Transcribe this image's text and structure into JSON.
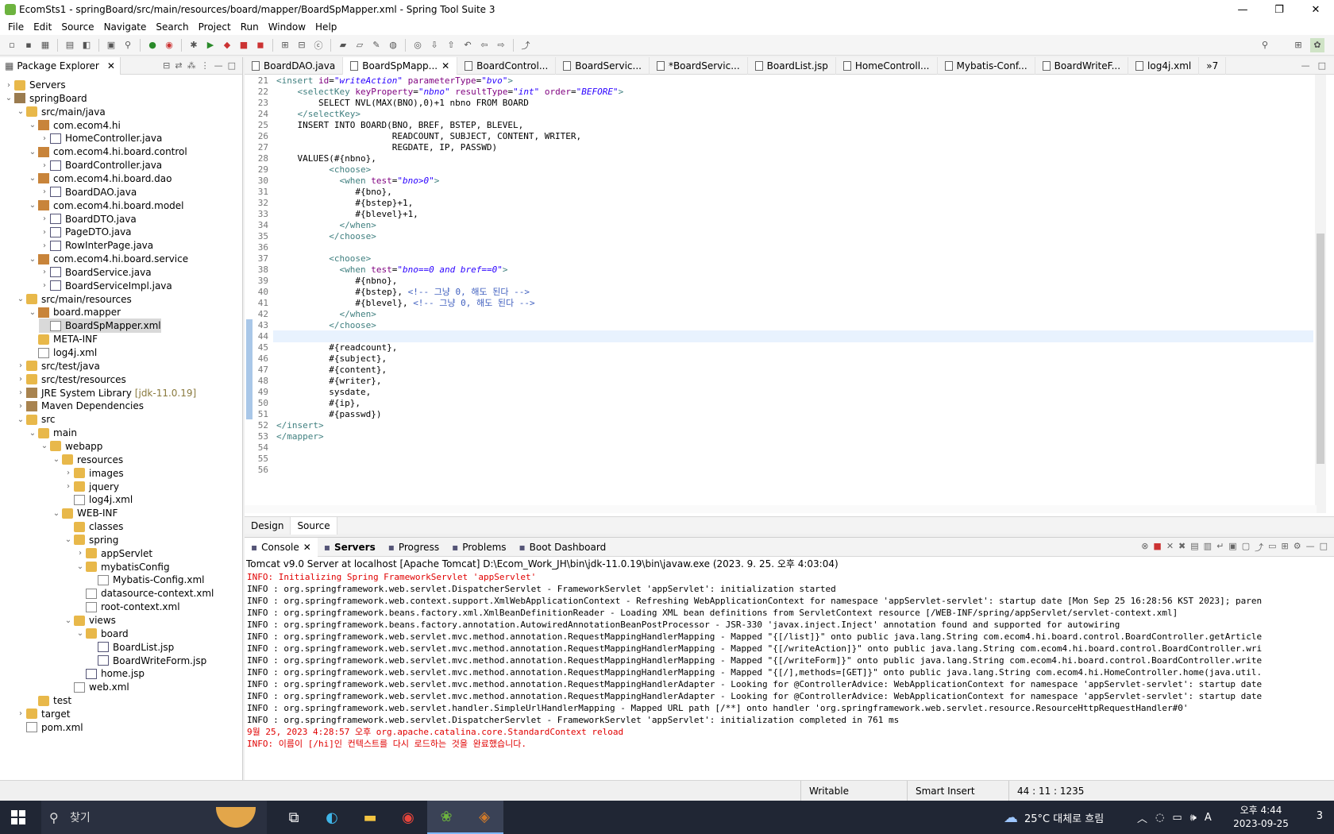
{
  "window": {
    "title": "EcomSts1 - springBoard/src/main/resources/board/mapper/BoardSpMapper.xml - Spring Tool Suite 3"
  },
  "menu": [
    "File",
    "Edit",
    "Source",
    "Navigate",
    "Search",
    "Project",
    "Run",
    "Window",
    "Help"
  ],
  "package_explorer": {
    "title": "Package Explorer",
    "tree": [
      {
        "label": "Servers",
        "depth": 0,
        "icon": "folder",
        "arrow": "›"
      },
      {
        "label": "springBoard",
        "depth": 0,
        "icon": "proj",
        "arrow": "⌄"
      },
      {
        "label": "src/main/java",
        "depth": 1,
        "icon": "folder",
        "arrow": "⌄"
      },
      {
        "label": "com.ecom4.hi",
        "depth": 2,
        "icon": "pkg",
        "arrow": "⌄"
      },
      {
        "label": "HomeController.java",
        "depth": 3,
        "icon": "java",
        "arrow": "›"
      },
      {
        "label": "com.ecom4.hi.board.control",
        "depth": 2,
        "icon": "pkg",
        "arrow": "⌄"
      },
      {
        "label": "BoardController.java",
        "depth": 3,
        "icon": "java",
        "arrow": "›"
      },
      {
        "label": "com.ecom4.hi.board.dao",
        "depth": 2,
        "icon": "pkg",
        "arrow": "⌄"
      },
      {
        "label": "BoardDAO.java",
        "depth": 3,
        "icon": "java",
        "arrow": "›"
      },
      {
        "label": "com.ecom4.hi.board.model",
        "depth": 2,
        "icon": "pkg",
        "arrow": "⌄"
      },
      {
        "label": "BoardDTO.java",
        "depth": 3,
        "icon": "java",
        "arrow": "›"
      },
      {
        "label": "PageDTO.java",
        "depth": 3,
        "icon": "java",
        "arrow": "›"
      },
      {
        "label": "RowInterPage.java",
        "depth": 3,
        "icon": "java",
        "arrow": "›"
      },
      {
        "label": "com.ecom4.hi.board.service",
        "depth": 2,
        "icon": "pkg",
        "arrow": "⌄"
      },
      {
        "label": "BoardService.java",
        "depth": 3,
        "icon": "java",
        "arrow": "›"
      },
      {
        "label": "BoardServiceImpl.java",
        "depth": 3,
        "icon": "java",
        "arrow": "›"
      },
      {
        "label": "src/main/resources",
        "depth": 1,
        "icon": "folder",
        "arrow": "⌄"
      },
      {
        "label": "board.mapper",
        "depth": 2,
        "icon": "pkg",
        "arrow": "⌄"
      },
      {
        "label": "BoardSpMapper.xml",
        "depth": 3,
        "icon": "xml",
        "arrow": "",
        "selected": true
      },
      {
        "label": "META-INF",
        "depth": 2,
        "icon": "folder",
        "arrow": ""
      },
      {
        "label": "log4j.xml",
        "depth": 2,
        "icon": "xml",
        "arrow": ""
      },
      {
        "label": "src/test/java",
        "depth": 1,
        "icon": "folder",
        "arrow": "›"
      },
      {
        "label": "src/test/resources",
        "depth": 1,
        "icon": "folder",
        "arrow": "›"
      },
      {
        "label": "JRE System Library",
        "extra": "[jdk-11.0.19]",
        "depth": 1,
        "icon": "lib",
        "arrow": "›"
      },
      {
        "label": "Maven Dependencies",
        "depth": 1,
        "icon": "lib",
        "arrow": "›"
      },
      {
        "label": "src",
        "depth": 1,
        "icon": "folder",
        "arrow": "⌄"
      },
      {
        "label": "main",
        "depth": 2,
        "icon": "folder",
        "arrow": "⌄"
      },
      {
        "label": "webapp",
        "depth": 3,
        "icon": "folder",
        "arrow": "⌄"
      },
      {
        "label": "resources",
        "depth": 4,
        "icon": "folder",
        "arrow": "⌄"
      },
      {
        "label": "images",
        "depth": 5,
        "icon": "folder",
        "arrow": "›"
      },
      {
        "label": "jquery",
        "depth": 5,
        "icon": "folder",
        "arrow": "›"
      },
      {
        "label": "log4j.xml",
        "depth": 5,
        "icon": "xml",
        "arrow": ""
      },
      {
        "label": "WEB-INF",
        "depth": 4,
        "icon": "folder",
        "arrow": "⌄"
      },
      {
        "label": "classes",
        "depth": 5,
        "icon": "folder",
        "arrow": ""
      },
      {
        "label": "spring",
        "depth": 5,
        "icon": "folder",
        "arrow": "⌄"
      },
      {
        "label": "appServlet",
        "depth": 6,
        "icon": "folder",
        "arrow": "›"
      },
      {
        "label": "mybatisConfig",
        "depth": 6,
        "icon": "folder",
        "arrow": "⌄"
      },
      {
        "label": "Mybatis-Config.xml",
        "depth": 7,
        "icon": "xml",
        "arrow": ""
      },
      {
        "label": "datasource-context.xml",
        "depth": 6,
        "icon": "xml",
        "arrow": ""
      },
      {
        "label": "root-context.xml",
        "depth": 6,
        "icon": "xml",
        "arrow": ""
      },
      {
        "label": "views",
        "depth": 5,
        "icon": "folder",
        "arrow": "⌄"
      },
      {
        "label": "board",
        "depth": 6,
        "icon": "folder",
        "arrow": "⌄"
      },
      {
        "label": "BoardList.jsp",
        "depth": 7,
        "icon": "java",
        "arrow": ""
      },
      {
        "label": "BoardWriteForm.jsp",
        "depth": 7,
        "icon": "java",
        "arrow": ""
      },
      {
        "label": "home.jsp",
        "depth": 6,
        "icon": "java",
        "arrow": ""
      },
      {
        "label": "web.xml",
        "depth": 5,
        "icon": "xml",
        "arrow": ""
      },
      {
        "label": "test",
        "depth": 2,
        "icon": "folder",
        "arrow": ""
      },
      {
        "label": "target",
        "depth": 1,
        "icon": "folder",
        "arrow": "›"
      },
      {
        "label": "pom.xml",
        "depth": 1,
        "icon": "xml",
        "arrow": ""
      }
    ]
  },
  "editor": {
    "tabs": [
      {
        "label": "BoardDAO.java",
        "active": false
      },
      {
        "label": "BoardSpMapp...",
        "active": true,
        "closable": true
      },
      {
        "label": "BoardControl...",
        "active": false
      },
      {
        "label": "BoardServic...",
        "active": false
      },
      {
        "label": "*BoardServic...",
        "active": false
      },
      {
        "label": "BoardList.jsp",
        "active": false
      },
      {
        "label": "HomeControll...",
        "active": false
      },
      {
        "label": "Mybatis-Conf...",
        "active": false
      },
      {
        "label": "BoardWriteF...",
        "active": false
      },
      {
        "label": "log4j.xml",
        "active": false
      },
      {
        "label": "»7",
        "active": false
      }
    ],
    "lines": [
      {
        "n": "21",
        "html": "<span class=\"tag\">&lt;insert</span> <span class=\"att\">id</span>=<span class=\"val\">\"writeAction\"</span> <span class=\"att\">parameterType</span>=<span class=\"val\">\"bvo\"</span><span class=\"tag\">&gt;</span>"
      },
      {
        "n": "22",
        "html": "    <span class=\"tag\">&lt;selectKey</span> <span class=\"att\">keyProperty</span>=<span class=\"val\">\"nbno\"</span> <span class=\"att\">resultType</span>=<span class=\"val\">\"int\"</span> <span class=\"att\">order</span>=<span class=\"val\">\"BEFORE\"</span><span class=\"tag\">&gt;</span>"
      },
      {
        "n": "23",
        "html": "        SELECT NVL(MAX(BNO),0)+1 nbno FROM BOARD"
      },
      {
        "n": "24",
        "html": "    <span class=\"tag\">&lt;/selectKey&gt;</span>"
      },
      {
        "n": "25",
        "html": "    INSERT INTO BOARD(BNO, BREF, BSTEP, BLEVEL,"
      },
      {
        "n": "26",
        "html": "                      READCOUNT, SUBJECT, CONTENT, WRITER,"
      },
      {
        "n": "27",
        "html": "                      REGDATE, IP, PASSWD)"
      },
      {
        "n": "28",
        "html": "    VALUES(#{nbno},"
      },
      {
        "n": "29",
        "html": "          <span class=\"tag\">&lt;choose&gt;</span>"
      },
      {
        "n": "30",
        "html": "            <span class=\"tag\">&lt;when</span> <span class=\"att\">test</span>=<span class=\"val\">\"bno&gt;0\"</span><span class=\"tag\">&gt;</span>"
      },
      {
        "n": "31",
        "html": "               #{bno},"
      },
      {
        "n": "32",
        "html": "               #{bstep}+1,"
      },
      {
        "n": "33",
        "html": "               #{blevel}+1,"
      },
      {
        "n": "34",
        "html": "            <span class=\"tag\">&lt;/when&gt;</span>"
      },
      {
        "n": "35",
        "html": "          <span class=\"tag\">&lt;/choose&gt;</span>"
      },
      {
        "n": "36",
        "html": ""
      },
      {
        "n": "37",
        "html": "          <span class=\"tag\">&lt;choose&gt;</span>"
      },
      {
        "n": "38",
        "html": "            <span class=\"tag\">&lt;when</span> <span class=\"att\">test</span>=<span class=\"val\">\"bno==0 and bref==0\"</span><span class=\"tag\">&gt;</span>"
      },
      {
        "n": "39",
        "html": "               #{nbno},"
      },
      {
        "n": "40",
        "html": "               #{bstep}, <span class=\"cmt\">&lt;!-- 그냥 0, 해도 된다 --&gt;</span>"
      },
      {
        "n": "41",
        "html": "               #{blevel}, <span class=\"cmt\">&lt;!-- 그냥 0, 해도 된다 --&gt;</span>"
      },
      {
        "n": "42",
        "html": "            <span class=\"tag\">&lt;/when&gt;</span>"
      },
      {
        "n": "43",
        "html": "          <span class=\"tag\">&lt;/choose&gt;</span>"
      },
      {
        "n": "44",
        "html": ""
      },
      {
        "n": "45",
        "html": "          #{readcount},"
      },
      {
        "n": "46",
        "html": "          #{subject},"
      },
      {
        "n": "47",
        "html": "          #{content},"
      },
      {
        "n": "48",
        "html": "          #{writer},"
      },
      {
        "n": "49",
        "html": "          sysdate,"
      },
      {
        "n": "50",
        "html": "          #{ip},"
      },
      {
        "n": "51",
        "html": "          #{passwd})"
      },
      {
        "n": "52",
        "html": "<span class=\"tag\">&lt;/insert&gt;</span>"
      },
      {
        "n": "53",
        "html": "<span class=\"tag\">&lt;/mapper&gt;</span>"
      },
      {
        "n": "54",
        "html": ""
      },
      {
        "n": "55",
        "html": ""
      },
      {
        "n": "56",
        "html": ""
      }
    ],
    "bottom_tabs": [
      "Design",
      "Source"
    ]
  },
  "console": {
    "tabs": [
      {
        "label": "Console",
        "active": true
      },
      {
        "label": "Servers",
        "active": false
      },
      {
        "label": "Progress",
        "active": false
      },
      {
        "label": "Problems",
        "active": false
      },
      {
        "label": "Boot Dashboard",
        "active": false
      }
    ],
    "header": "Tomcat v9.0 Server at localhost [Apache Tomcat] D:\\Ecom_Work_JH\\bin\\jdk-11.0.19\\bin\\javaw.exe  (2023. 9. 25. 오후 4:03:04)",
    "lines": [
      {
        "text": "INFO: Initializing Spring FrameworkServlet 'appServlet'",
        "red": true
      },
      {
        "text": "INFO : org.springframework.web.servlet.DispatcherServlet - FrameworkServlet 'appServlet': initialization started",
        "red": false
      },
      {
        "text": "INFO : org.springframework.web.context.support.XmlWebApplicationContext - Refreshing WebApplicationContext for namespace 'appServlet-servlet': startup date [Mon Sep 25 16:28:56 KST 2023]; paren",
        "red": false
      },
      {
        "text": "INFO : org.springframework.beans.factory.xml.XmlBeanDefinitionReader - Loading XML bean definitions from ServletContext resource [/WEB-INF/spring/appServlet/servlet-context.xml]",
        "red": false
      },
      {
        "text": "INFO : org.springframework.beans.factory.annotation.AutowiredAnnotationBeanPostProcessor - JSR-330 'javax.inject.Inject' annotation found and supported for autowiring",
        "red": false
      },
      {
        "text": "INFO : org.springframework.web.servlet.mvc.method.annotation.RequestMappingHandlerMapping - Mapped \"{[/list]}\" onto public java.lang.String com.ecom4.hi.board.control.BoardController.getArticle",
        "red": false
      },
      {
        "text": "INFO : org.springframework.web.servlet.mvc.method.annotation.RequestMappingHandlerMapping - Mapped \"{[/writeAction]}\" onto public java.lang.String com.ecom4.hi.board.control.BoardController.wri",
        "red": false
      },
      {
        "text": "INFO : org.springframework.web.servlet.mvc.method.annotation.RequestMappingHandlerMapping - Mapped \"{[/writeForm]}\" onto public java.lang.String com.ecom4.hi.board.control.BoardController.write",
        "red": false
      },
      {
        "text": "INFO : org.springframework.web.servlet.mvc.method.annotation.RequestMappingHandlerMapping - Mapped \"{[/],methods=[GET]}\" onto public java.lang.String com.ecom4.hi.HomeController.home(java.util.",
        "red": false
      },
      {
        "text": "INFO : org.springframework.web.servlet.mvc.method.annotation.RequestMappingHandlerAdapter - Looking for @ControllerAdvice: WebApplicationContext for namespace 'appServlet-servlet': startup date",
        "red": false
      },
      {
        "text": "INFO : org.springframework.web.servlet.mvc.method.annotation.RequestMappingHandlerAdapter - Looking for @ControllerAdvice: WebApplicationContext for namespace 'appServlet-servlet': startup date",
        "red": false
      },
      {
        "text": "INFO : org.springframework.web.servlet.handler.SimpleUrlHandlerMapping - Mapped URL path [/**] onto handler 'org.springframework.web.servlet.resource.ResourceHttpRequestHandler#0'",
        "red": false
      },
      {
        "text": "INFO : org.springframework.web.servlet.DispatcherServlet - FrameworkServlet 'appServlet': initialization completed in 761 ms",
        "red": false
      },
      {
        "text": "9월 25, 2023 4:28:57 오후 org.apache.catalina.core.StandardContext reload",
        "red": true
      },
      {
        "text": "INFO: 이름이 [/hi]인 컨텍스트를 다시 로드하는 것을 완료했습니다.",
        "red": true
      }
    ]
  },
  "status": {
    "mode": "Writable",
    "insert": "Smart Insert",
    "position": "44 : 11 : 1235"
  },
  "taskbar": {
    "search_placeholder": "찾기",
    "weather": "25°C 대체로 흐림",
    "time": "오후 4:44",
    "date": "2023-09-25",
    "notifications": "3"
  }
}
